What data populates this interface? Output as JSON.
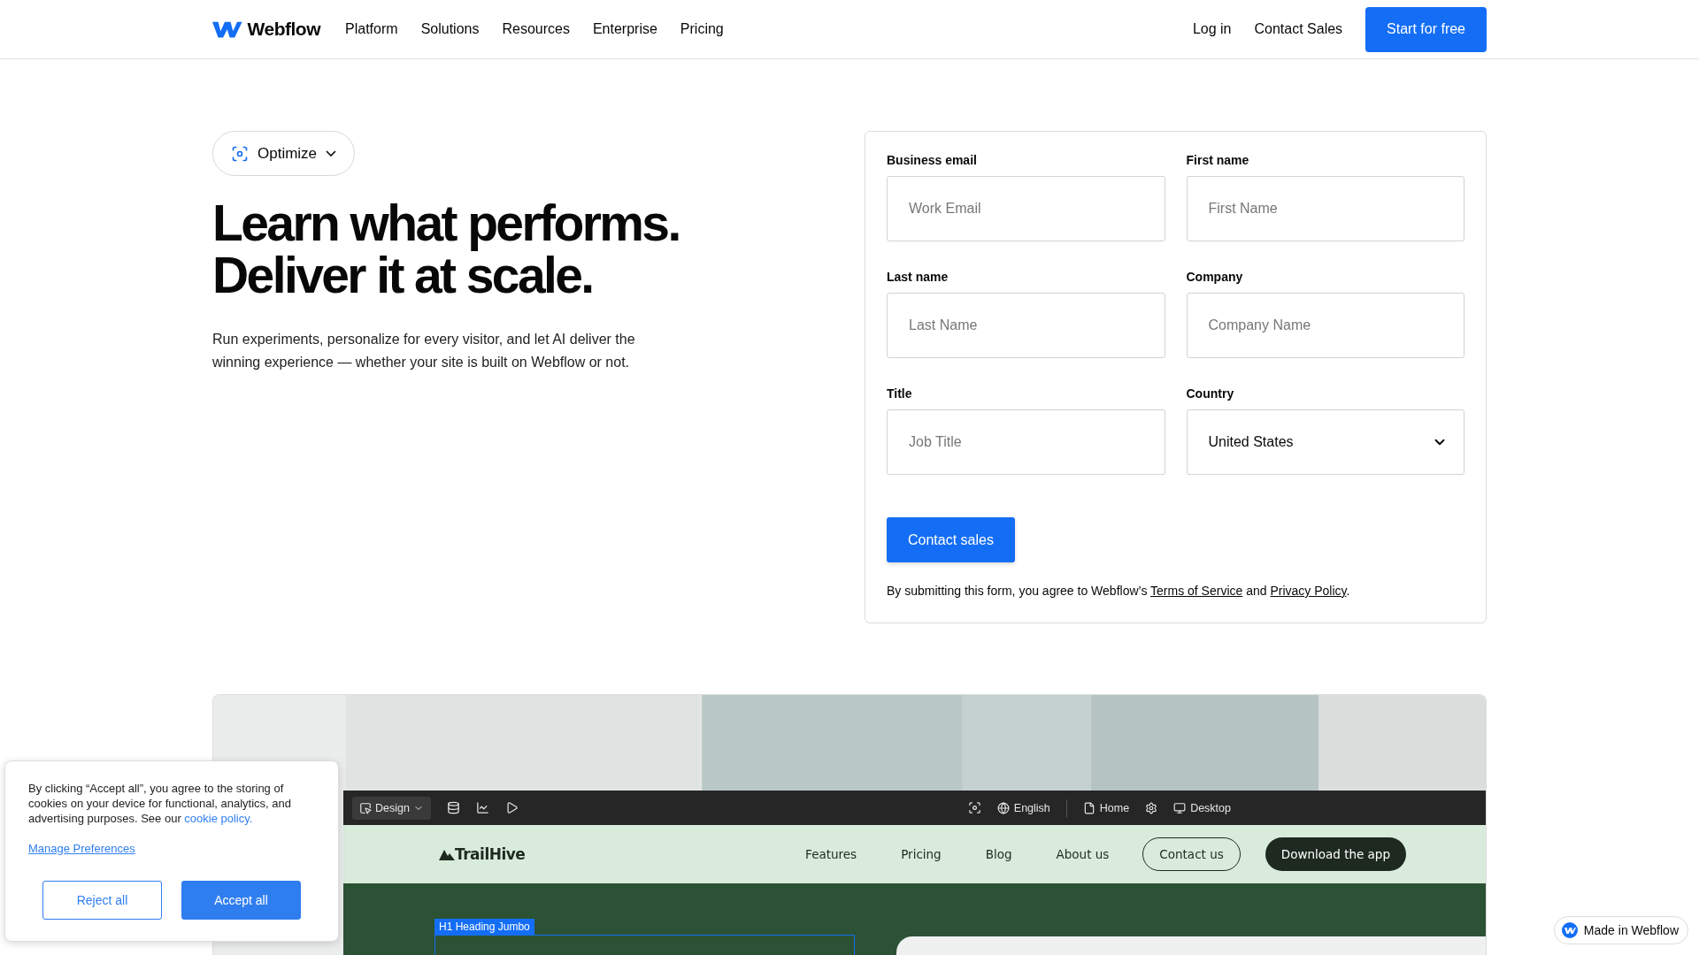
{
  "nav": {
    "brand": "Webflow",
    "links": [
      "Platform",
      "Solutions",
      "Resources",
      "Enterprise",
      "Pricing"
    ],
    "actions": [
      {
        "label": "Log in",
        "kind": "link"
      },
      {
        "label": "Contact Sales",
        "kind": "link"
      },
      {
        "label": "Start for free",
        "kind": "button"
      }
    ]
  },
  "hero": {
    "product_menu": "Optimize",
    "heading_lines": [
      "Learn what performs.",
      "Deliver it at scale."
    ],
    "description": "Run experiments, personalize for every visitor, and let AI deliver the winning experience — whether your site is built on Webflow or not."
  },
  "form": {
    "fields": [
      {
        "label": "Business email",
        "placeholder": "Work Email",
        "kind": "input"
      },
      {
        "label": "First name",
        "placeholder": "First Name",
        "kind": "input"
      },
      {
        "label": "Last name",
        "placeholder": "Last Name",
        "kind": "input"
      },
      {
        "label": "Company",
        "placeholder": "Company Name",
        "kind": "input"
      },
      {
        "label": "Title",
        "placeholder": "Job Title",
        "kind": "input"
      },
      {
        "label": "Country",
        "value": "United States",
        "kind": "select"
      }
    ],
    "submit": "Contact sales",
    "legal": {
      "before": "By submitting this form, you agree to Webflow’s ",
      "terms": "Terms of Service",
      "middle": " and ",
      "privacy": "Privacy Policy",
      "after": "."
    }
  },
  "preview": {
    "toolbar": {
      "mode": "Design",
      "locale": "English",
      "page": "Home",
      "breakpoint": "Desktop"
    },
    "site": {
      "brand": "TrailHive",
      "links": [
        "Features",
        "Pricing",
        "Blog",
        "About us"
      ],
      "contact": "Contact us",
      "download": "Download the app"
    },
    "selection_tag": {
      "tag": "H1",
      "label": "Heading Jumbo"
    }
  },
  "cookie_banner": {
    "text": "By clicking “Accept all”, you agree to the storing of cookies on your device for functional, analytics, and advertising purposes. See our ",
    "policy_link": "cookie policy.",
    "manage": "Manage Preferences",
    "reject": "Reject all",
    "accept": "Accept all"
  },
  "badge": "Made in Webflow"
}
